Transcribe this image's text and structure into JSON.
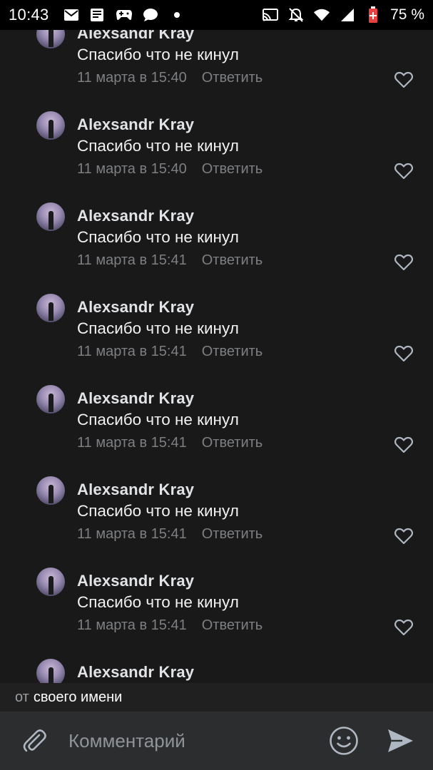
{
  "status_bar": {
    "time": "10:43",
    "battery_percent": "75 %",
    "left_icons": [
      "mail-icon",
      "news-icon",
      "gamepad-icon",
      "chat-bubble-icon",
      "dot-icon"
    ],
    "right_icons": [
      "cast-icon",
      "bell-off-icon",
      "wifi-icon",
      "signal-icon",
      "battery-icon"
    ]
  },
  "comments": [
    {
      "author": "Alexsandr Kray",
      "text": "Спасибо что не кинул",
      "date": "11 марта в 15:40",
      "reply_label": "Ответить"
    },
    {
      "author": "Alexsandr Kray",
      "text": "Спасибо что не кинул",
      "date": "11 марта в 15:40",
      "reply_label": "Ответить"
    },
    {
      "author": "Alexsandr Kray",
      "text": "Спасибо что не кинул",
      "date": "11 марта в 15:41",
      "reply_label": "Ответить"
    },
    {
      "author": "Alexsandr Kray",
      "text": "Спасибо что не кинул",
      "date": "11 марта в 15:41",
      "reply_label": "Ответить"
    },
    {
      "author": "Alexsandr Kray",
      "text": "Спасибо что не кинул",
      "date": "11 марта в 15:41",
      "reply_label": "Ответить"
    },
    {
      "author": "Alexsandr Kray",
      "text": "Спасибо что не кинул",
      "date": "11 марта в 15:41",
      "reply_label": "Ответить"
    },
    {
      "author": "Alexsandr Kray",
      "text": "Спасибо что не кинул",
      "date": "11 марта в 15:41",
      "reply_label": "Ответить"
    },
    {
      "author": "Alexsandr Kray"
    }
  ],
  "identity": {
    "prefix": "от",
    "value": "своего имени"
  },
  "composer": {
    "placeholder": "Комментарий"
  },
  "colors": {
    "background": "#191919",
    "composer_bg": "#2c2d2e",
    "secondary_text": "#7d7f82",
    "icon": "#aeb7c2"
  }
}
